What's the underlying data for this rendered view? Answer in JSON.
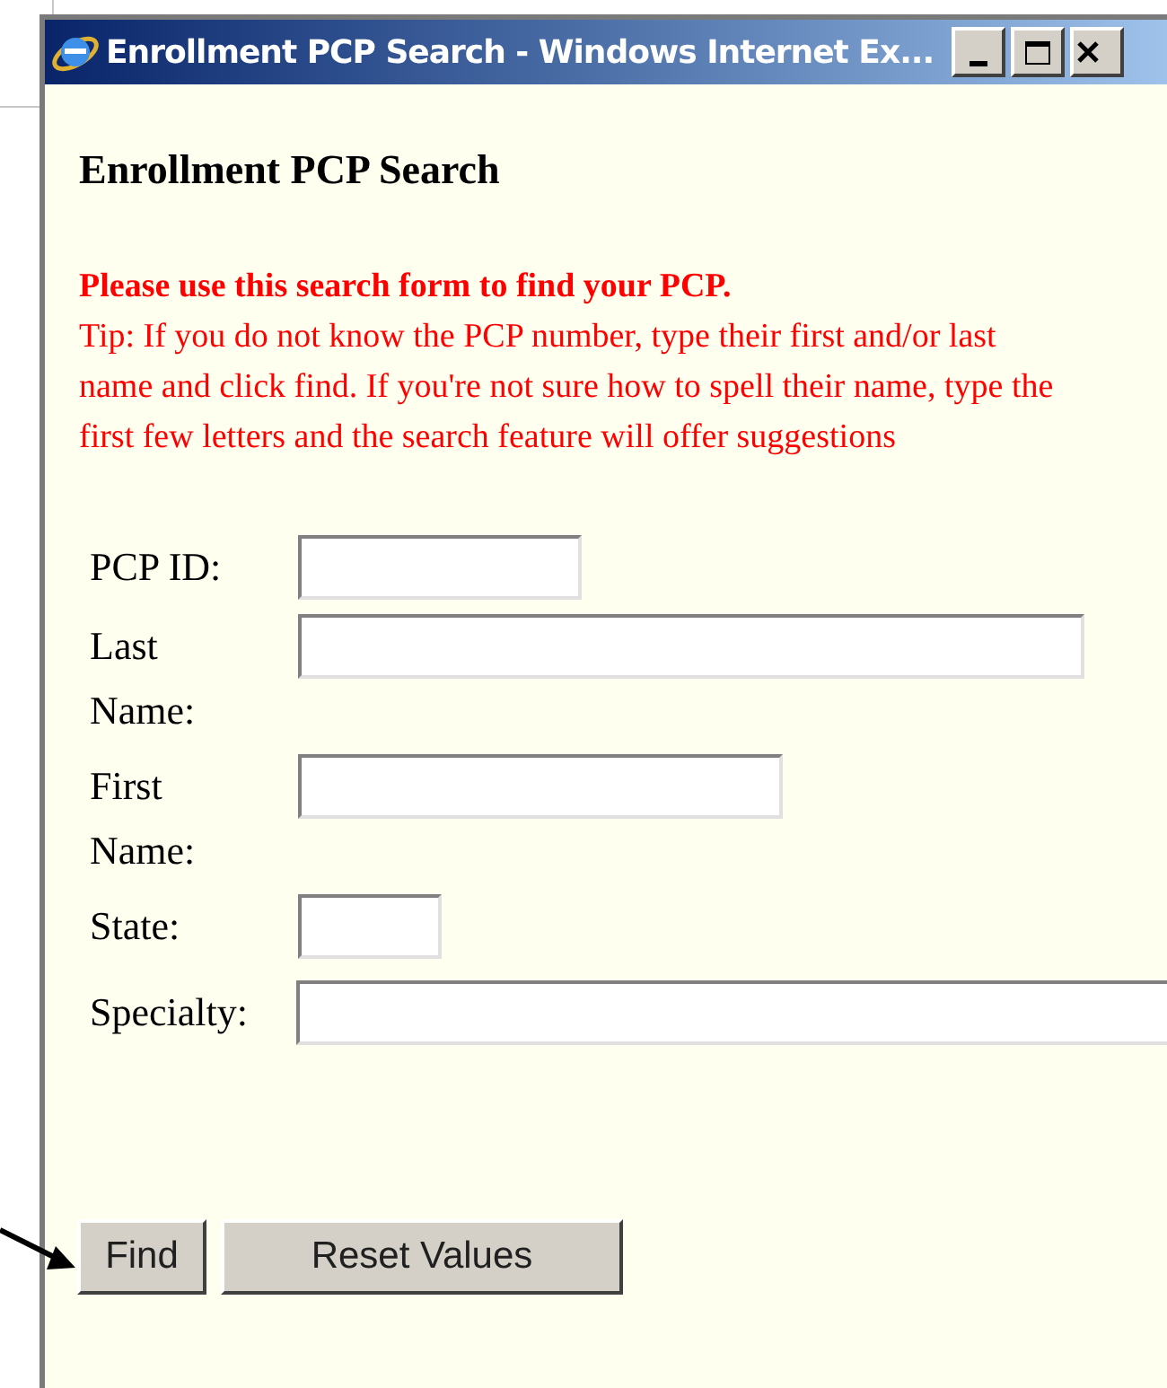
{
  "window": {
    "title": "Enrollment PCP Search - Windows Internet Ex..."
  },
  "heading": "Enrollment PCP Search",
  "notice": "Please use this search form to find your PCP.",
  "tip": "Tip: If you do not know the PCP number, type their first and/or last name and click find. If you're not sure how to spell their name, type the first few letters and the search feature will offer suggestions",
  "fields": [
    {
      "label": "PCP ID:"
    },
    {
      "label": "Last Name:"
    },
    {
      "label": "First Name:"
    },
    {
      "label": "State:"
    },
    {
      "label": "Specialty:"
    }
  ],
  "buttons": [
    "Find",
    "Reset Values"
  ]
}
